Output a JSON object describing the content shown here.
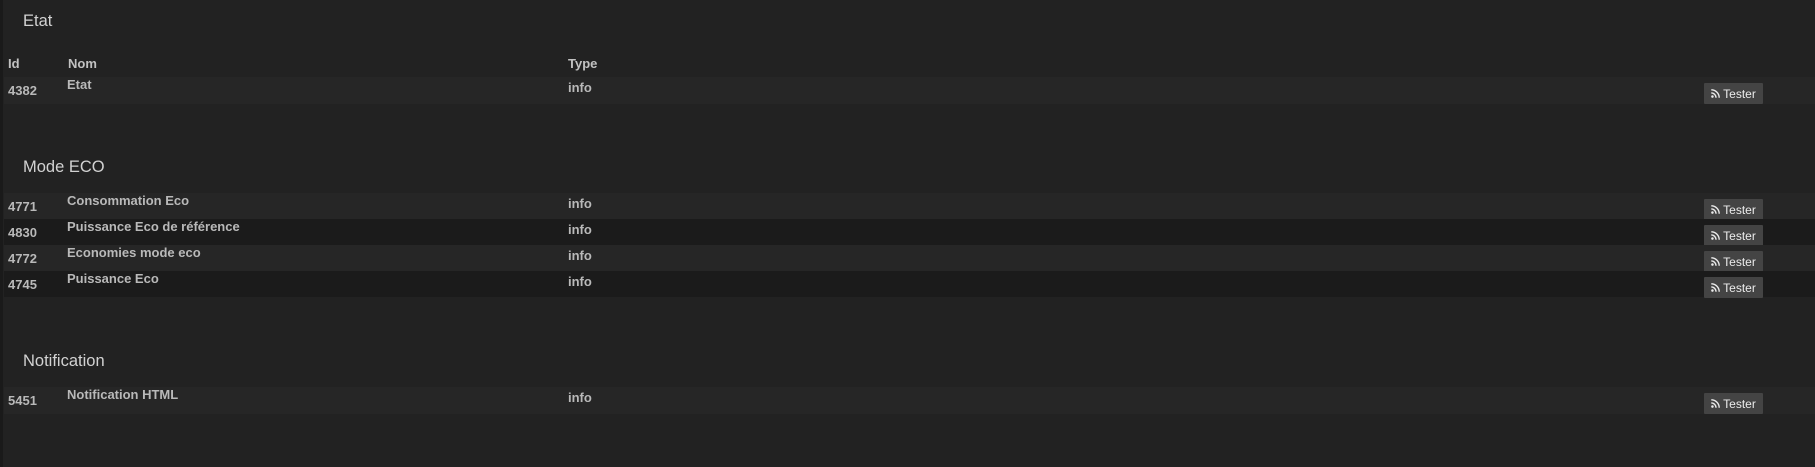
{
  "headers": {
    "id": "Id",
    "nom": "Nom",
    "type": "Type"
  },
  "sections": [
    {
      "title": "Etat",
      "rows": [
        {
          "id": "4382",
          "nom": "Etat",
          "type": "info",
          "action": "Tester"
        }
      ]
    },
    {
      "title": "Mode ECO",
      "rows": [
        {
          "id": "4771",
          "nom": "Consommation Eco",
          "type": "info",
          "action": "Tester"
        },
        {
          "id": "4830",
          "nom": "Puissance Eco de référence",
          "type": "info",
          "action": "Tester"
        },
        {
          "id": "4772",
          "nom": "Economies mode eco",
          "type": "info",
          "action": "Tester"
        },
        {
          "id": "4745",
          "nom": "Puissance Eco",
          "type": "info",
          "action": "Tester"
        }
      ]
    },
    {
      "title": "Notification",
      "rows": [
        {
          "id": "5451",
          "nom": "Notification HTML",
          "type": "info",
          "action": "Tester"
        }
      ]
    }
  ],
  "colors": {
    "background": "#222222",
    "row_dark": "#1b1b1b",
    "button_bg": "#444444",
    "text": "#b9b9b9"
  },
  "icons": {
    "test_button": "rss-icon"
  }
}
